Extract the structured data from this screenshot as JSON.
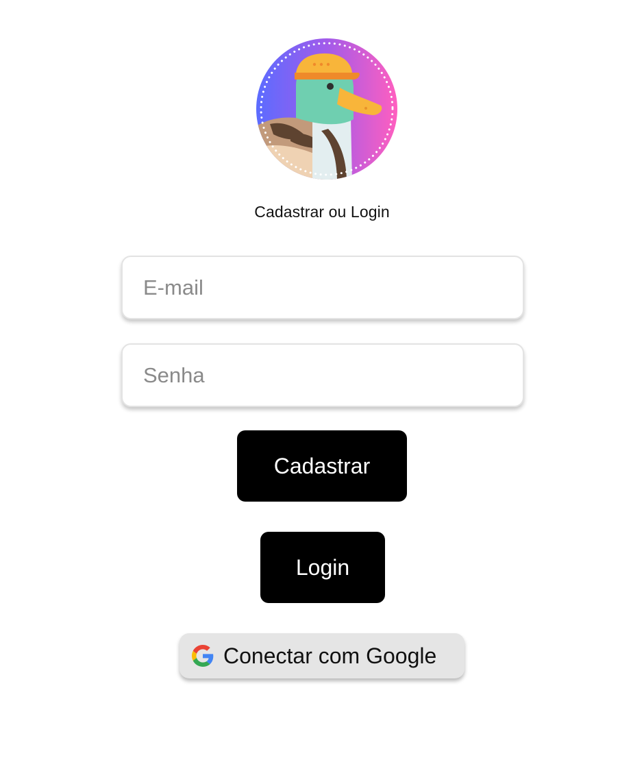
{
  "header": {
    "title": "Cadastrar ou Login",
    "avatar_icon": "duck-avatar-icon",
    "avatar_gradient": [
      "#5b6cff",
      "#ff5fbf"
    ]
  },
  "form": {
    "email": {
      "placeholder": "E-mail",
      "value": ""
    },
    "password": {
      "placeholder": "Senha",
      "value": ""
    }
  },
  "actions": {
    "register_label": "Cadastrar",
    "login_label": "Login",
    "google_label": "Conectar com Google",
    "google_icon": "google-g-icon"
  },
  "colors": {
    "primary_button": "#000000",
    "primary_button_text": "#ffffff",
    "google_button": "#e5e5e5"
  }
}
